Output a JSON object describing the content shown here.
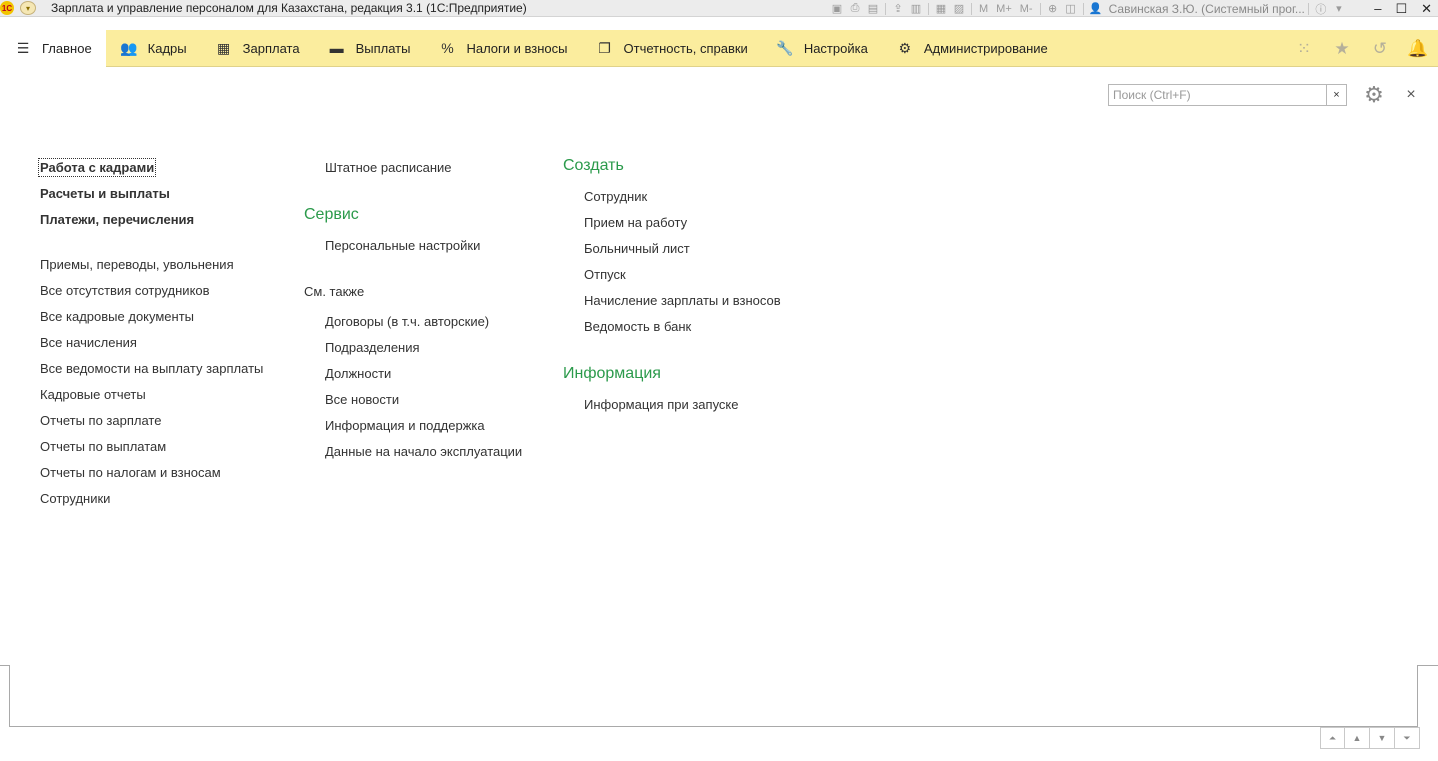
{
  "window": {
    "title": "Зарплата и управление персоналом для Казахстана, редакция 3.1  (1С:Предприятие)",
    "logo_text": "1С",
    "toolbar_memory": [
      "M",
      "M+",
      "M-"
    ],
    "user": "Савинская З.Ю. (Системный прог..."
  },
  "sections": [
    {
      "label": "Главное",
      "icon": "hamburger-icon"
    },
    {
      "label": "Кадры",
      "icon": "users-icon"
    },
    {
      "label": "Зарплата",
      "icon": "calculator-icon"
    },
    {
      "label": "Выплаты",
      "icon": "wallet-icon"
    },
    {
      "label": "Налоги и взносы",
      "icon": "percent-icon"
    },
    {
      "label": "Отчетность, справки",
      "icon": "documents-icon"
    },
    {
      "label": "Настройка",
      "icon": "wrench-icon"
    },
    {
      "label": "Администрирование",
      "icon": "gear-icon"
    }
  ],
  "active_section": "Главное",
  "search": {
    "placeholder": "Поиск (Ctrl+F)",
    "value": ""
  },
  "column1": {
    "bold_links": [
      "Работа с кадрами",
      "Расчеты и выплаты",
      "Платежи, перечисления"
    ],
    "links": [
      "Приемы, переводы, увольнения",
      "Все отсутствия сотрудников",
      "Все кадровые документы",
      "Все начисления",
      "Все ведомости на выплату зарплаты",
      "Кадровые отчеты",
      "Отчеты по зарплате",
      "Отчеты по выплатам",
      "Отчеты по налогам и взносам",
      "Сотрудники"
    ]
  },
  "column2": {
    "top_links": [
      "Штатное расписание"
    ],
    "service": {
      "title": "Сервис",
      "links": [
        "Персональные настройки"
      ]
    },
    "see_also": {
      "title": "См. также",
      "links": [
        "Договоры (в т.ч. авторские)",
        "Подразделения",
        "Должности",
        "Все новости",
        "Информация и поддержка",
        "Данные на начало эксплуатации"
      ]
    }
  },
  "column3": {
    "create": {
      "title": "Создать",
      "links": [
        "Сотрудник",
        "Прием на работу",
        "Больничный лист",
        "Отпуск",
        "Начисление зарплаты и взносов",
        "Ведомость в банк"
      ]
    },
    "info": {
      "title": "Информация",
      "links": [
        "Информация при запуске"
      ]
    }
  },
  "colors": {
    "accent_green": "#2b9a4b",
    "section_bar": "#fbed9e"
  }
}
